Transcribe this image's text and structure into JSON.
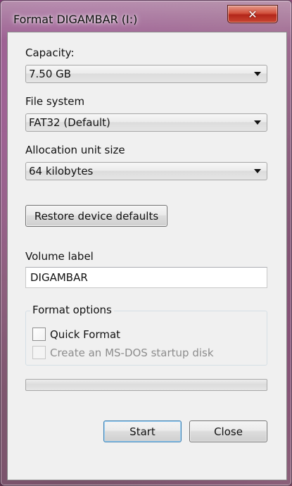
{
  "window": {
    "title": "Format DIGAMBAR (I:)",
    "close_glyph": "✕"
  },
  "capacity": {
    "label": "Capacity:",
    "value": "7.50 GB"
  },
  "file_system": {
    "label": "File system",
    "value": "FAT32 (Default)"
  },
  "allocation": {
    "label": "Allocation unit size",
    "value": "64 kilobytes"
  },
  "restore_button": "Restore device defaults",
  "volume": {
    "label": "Volume label",
    "value": "DIGAMBAR"
  },
  "format_options": {
    "title": "Format options",
    "quick_format": {
      "label": "Quick Format",
      "checked": false,
      "enabled": true
    },
    "msdos_disk": {
      "label": "Create an MS-DOS startup disk",
      "checked": false,
      "enabled": false
    }
  },
  "progress": {
    "fraction": 0
  },
  "buttons": {
    "start": "Start",
    "close": "Close"
  },
  "colors": {
    "close_button": "#c94632",
    "default_button_border": "#3c7fb1"
  }
}
